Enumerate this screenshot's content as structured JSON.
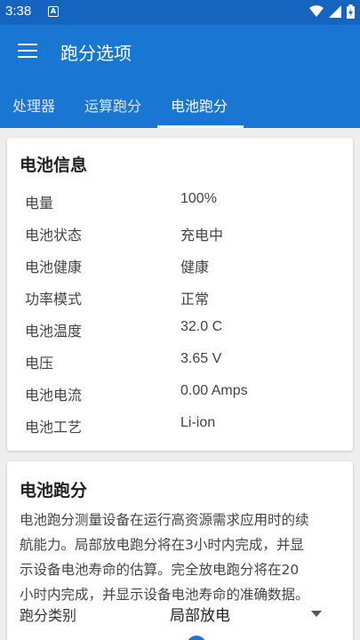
{
  "status_bar": {
    "time": "3:38",
    "notification_letter": "A",
    "icons": [
      "wifi-icon",
      "signal-icon",
      "battery-charging-icon"
    ]
  },
  "app_bar": {
    "title": "跑分选项",
    "menu_icon": "hamburger-menu-icon"
  },
  "tabs": [
    {
      "label": "处理器",
      "active": false
    },
    {
      "label": "运算跑分",
      "active": false
    },
    {
      "label": "电池跑分",
      "active": true
    }
  ],
  "battery_info": {
    "title": "电池信息",
    "rows": [
      {
        "label": "电量",
        "value": "100%"
      },
      {
        "label": "电池状态",
        "value": "充电中"
      },
      {
        "label": "电池健康",
        "value": "健康"
      },
      {
        "label": "功率模式",
        "value": "正常"
      },
      {
        "label": "电池温度",
        "value": "32.0 C"
      },
      {
        "label": "电压",
        "value": "3.65 V"
      },
      {
        "label": "电池电流",
        "value": "0.00 Amps"
      },
      {
        "label": "电池工艺",
        "value": "Li-ion"
      }
    ]
  },
  "battery_benchmark": {
    "title": "电池跑分",
    "description_lines": [
      "电池跑分测量设备在运行高资源需求应用时的续",
      "航能力。局部放电跑分将在3小时内完成，并显",
      "示设备电池寿命的估算。完全放电跑分将在20",
      "小时内完成，并显示设备电池寿命的准确数据。"
    ],
    "type_label": "跑分类别",
    "type_value": "局部放电",
    "next_row_label": "ㅡ"
  },
  "colors": {
    "status_bar": "#1565c0",
    "app_bar": "#1976d2",
    "background": "#eeeeee",
    "card": "#ffffff"
  }
}
